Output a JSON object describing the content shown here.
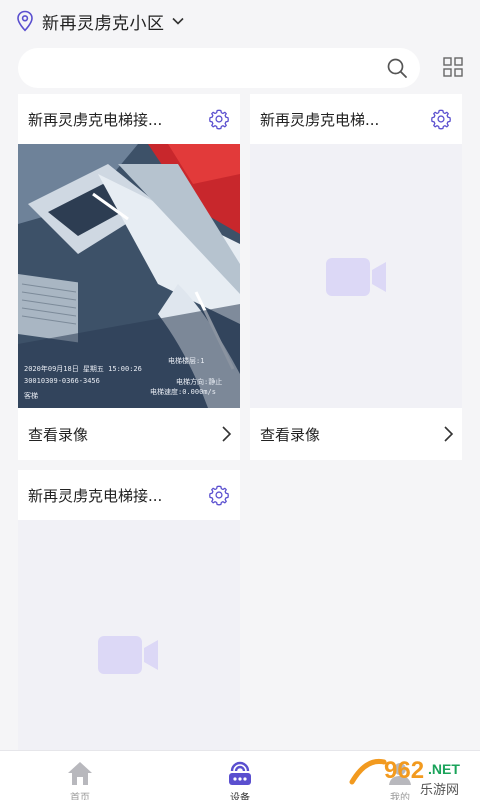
{
  "header": {
    "community": "新再灵虏克小区"
  },
  "search": {
    "placeholder": ""
  },
  "cards": [
    {
      "title": "新再灵虏克电梯接...",
      "footer": "查看录像"
    },
    {
      "title": "新再灵虏克电梯...",
      "footer": "查看录像"
    },
    {
      "title": "新再灵虏克电梯接..."
    }
  ],
  "snapshot": {
    "line1_left": "2020年09月18日 星期五 15:00:26",
    "line1_right": "电梯楼层:1",
    "line2_left": "30010309-0366-3456",
    "line2_right": "电梯方向:静止",
    "line3_left": "客梯",
    "line3_right": "电梯速度:0.000m/s"
  },
  "tabs": [
    {
      "label": "首页"
    },
    {
      "label": "设备"
    },
    {
      "label": "我的"
    }
  ],
  "watermark": {
    "brand": "962",
    "suffix": ".NET",
    "subtitle": "乐游网"
  },
  "colors": {
    "accent": "#5a4fcf",
    "cam_placeholder": "#dcd8f6",
    "background": "#f5f5f7"
  }
}
